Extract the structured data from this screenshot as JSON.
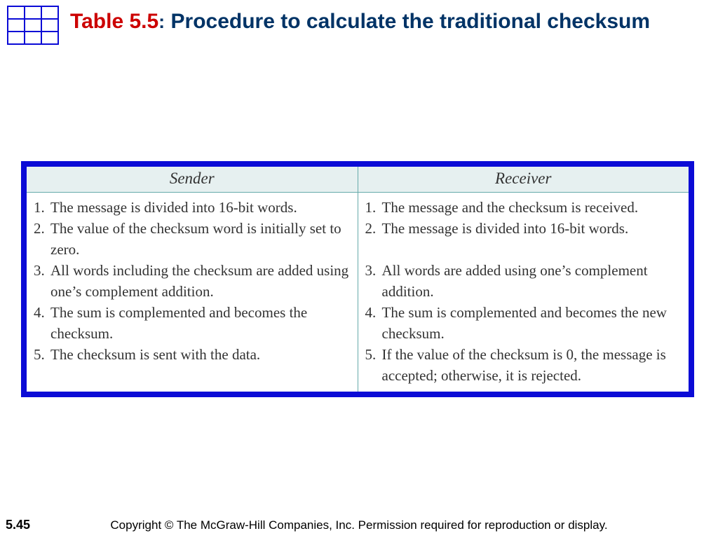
{
  "title": {
    "table_label": "Table 5.5",
    "colon": ":",
    "description": "  Procedure to calculate the traditional checksum"
  },
  "table": {
    "headers": {
      "left": "Sender",
      "right": "Receiver"
    },
    "sender": [
      {
        "n": "1.",
        "t": "The message is divided into 16-bit words."
      },
      {
        "n": "2.",
        "t": "The value of the checksum word is initially set to zero."
      },
      {
        "n": "3.",
        "t": "All words including the checksum are added using one’s complement addition."
      },
      {
        "n": "4.",
        "t": "The sum is complemented and becomes the checksum."
      },
      {
        "n": "5.",
        "t": "The checksum is sent with the data."
      }
    ],
    "receiver": [
      {
        "n": "1.",
        "t": "The message and the checksum is received."
      },
      {
        "n": "2.",
        "t": "The message is divided into 16-bit words."
      },
      {
        "n": "3.",
        "t": "All words are added using one’s comple­ment addition."
      },
      {
        "n": "4.",
        "t": "The sum is complemented and becomes the new checksum."
      },
      {
        "n": "5.",
        "t": "If the value of the checksum is 0, the message is accepted; otherwise, it is rejected."
      }
    ]
  },
  "footer": {
    "page": "5.45",
    "copyright": "Copyright © The McGraw-Hill Companies, Inc. Permission required for reproduction or display."
  }
}
